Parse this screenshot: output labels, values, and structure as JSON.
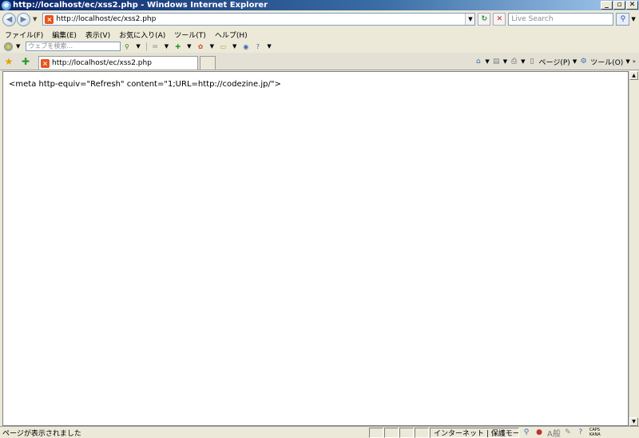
{
  "window": {
    "title": "http://localhost/ec/xss2.php - Windows Internet Explorer",
    "buttons": {
      "minimize": "_",
      "maximize": "▫",
      "close": "✕"
    }
  },
  "address_bar": {
    "url": "http://localhost/ec/xss2.php",
    "search_placeholder": "Live Search"
  },
  "menu": {
    "items": [
      "ファイル(F)",
      "編集(E)",
      "表示(V)",
      "お気に入り(A)",
      "ツール(T)",
      "ヘルプ(H)"
    ]
  },
  "toolbar": {
    "web_search_placeholder": "ウェブを検索..."
  },
  "tabs": {
    "active_tab_label": "http://localhost/ec/xss2.php"
  },
  "command_bar": {
    "page_label": "ページ(P)",
    "tools_label": "ツール(O)"
  },
  "content": {
    "text": "<meta http-equiv=\"Refresh\" content=\"1;URL=http://codezine.jp/\">"
  },
  "status_bar": {
    "status_text": "ページが表示されました",
    "zone_text": "インターネット | 保護モード: 有",
    "ime_text": "A般",
    "caps_text": "CAPS",
    "kana_text": "KANA"
  },
  "colors": {
    "title_gradient_start": "#0a246a",
    "chrome_bg": "#ece9d8",
    "page_icon": "#e8541c"
  }
}
